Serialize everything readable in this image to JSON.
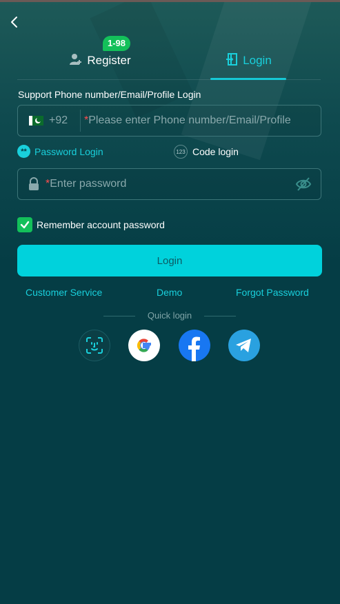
{
  "header": {
    "back_icon": "chevron-left-icon"
  },
  "tabs": {
    "register": {
      "label": "Register",
      "badge": "1-98",
      "icon": "user-add-icon"
    },
    "login": {
      "label": "Login",
      "icon": "login-door-icon",
      "active": true
    }
  },
  "form": {
    "support_text": "Support Phone number/Email/Profile Login",
    "phone": {
      "country_flag": "pakistan-flag-icon",
      "dial_code": "+92",
      "required_mark": "*",
      "placeholder": "Please enter Phone number/Email/Profile"
    },
    "methods": {
      "password": {
        "label": "Password Login",
        "icon_text": "**",
        "active": true
      },
      "code": {
        "label": "Code login",
        "icon_text": "123"
      }
    },
    "password": {
      "required_mark": "*",
      "placeholder": "Enter password",
      "lock_icon": "lock-icon",
      "visibility_icon": "eye-off-icon"
    },
    "remember": {
      "label": "Remember account password",
      "checked": true
    },
    "submit_label": "Login"
  },
  "links": {
    "customer_service": "Customer Service",
    "demo": "Demo",
    "forgot_password": "Forgot Password"
  },
  "quick_login": {
    "label": "Quick login",
    "providers": [
      "face-id-icon",
      "google-icon",
      "facebook-icon",
      "telegram-icon"
    ]
  },
  "colors": {
    "background": "#053d45",
    "accent": "#19d0dc",
    "button": "#00d2dc",
    "success": "#13c05a",
    "required": "#ff4d4f"
  }
}
